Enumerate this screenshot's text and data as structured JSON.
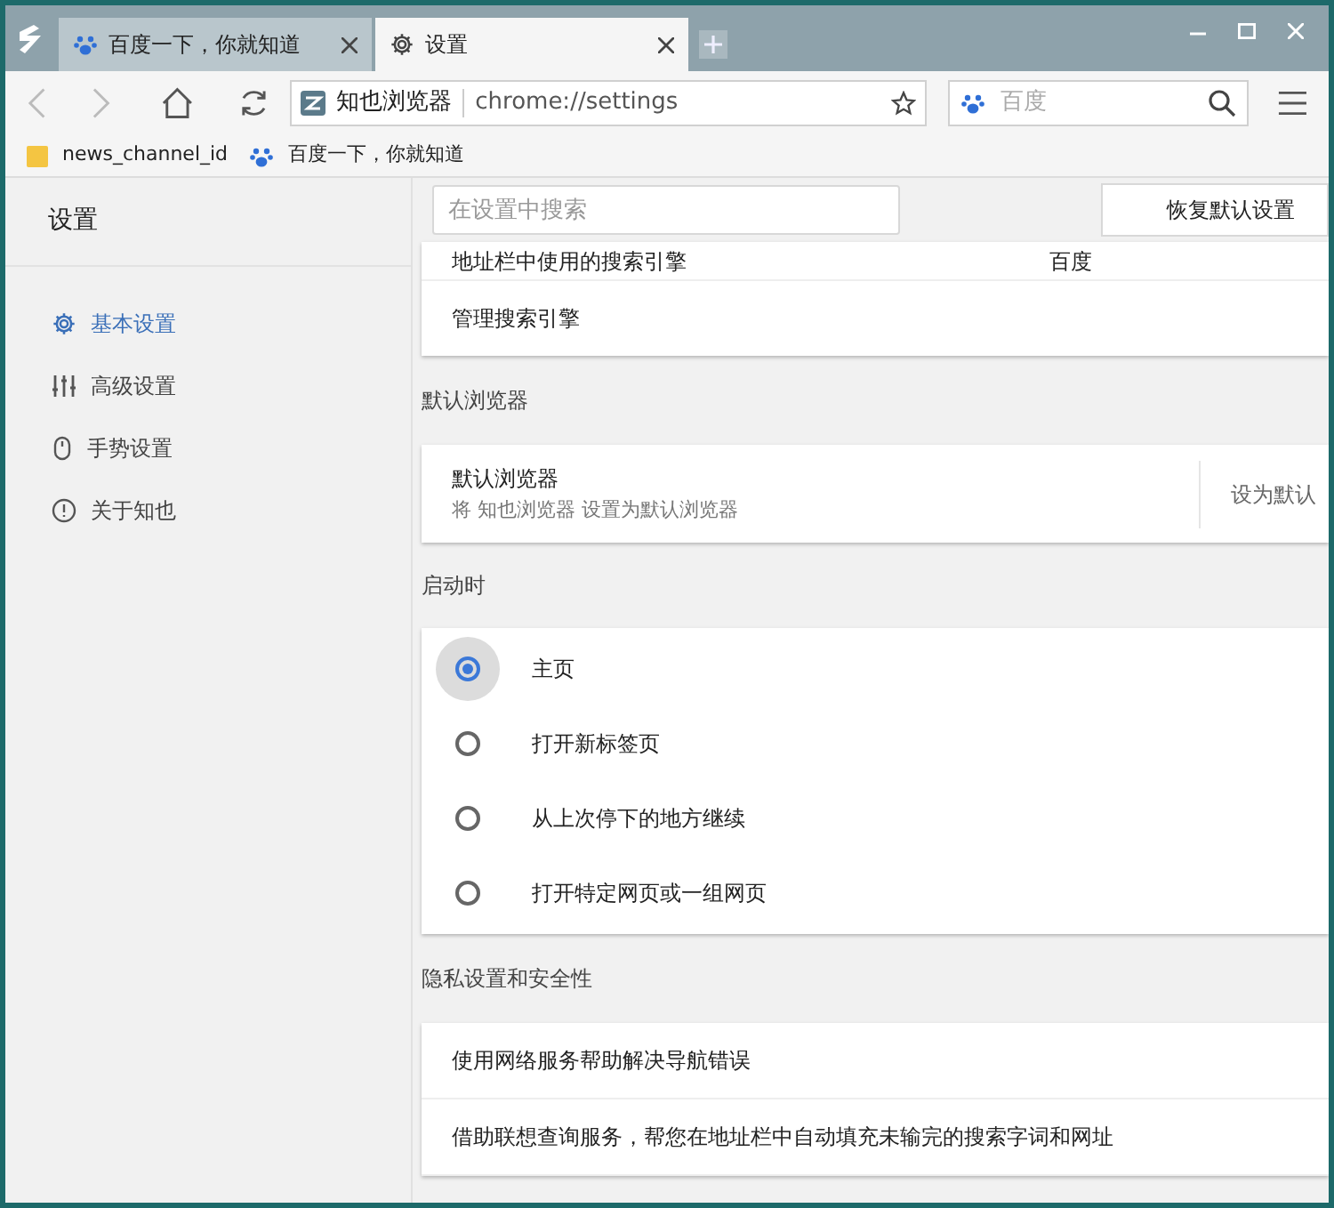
{
  "tabs": [
    {
      "label": "百度一下，你就知道",
      "kind": "paw",
      "selected": false
    },
    {
      "label": "设置",
      "kind": "gear",
      "selected": true
    }
  ],
  "address_bar": {
    "site": "知也浏览器",
    "url": "chrome://settings"
  },
  "search_box": {
    "placeholder": "百度"
  },
  "bookmarks": [
    {
      "label": "news_channel_id",
      "kind": "folder"
    },
    {
      "label": "百度一下，你就知道",
      "kind": "paw"
    }
  ],
  "sidebar": {
    "title": "设置",
    "items": [
      {
        "label": "基本设置",
        "kind": "gear",
        "selected": true
      },
      {
        "label": "高级设置",
        "kind": "sliders",
        "selected": false
      },
      {
        "label": "手势设置",
        "kind": "mouse",
        "selected": false
      },
      {
        "label": "关于知也",
        "kind": "info",
        "selected": false
      }
    ]
  },
  "settings_search": {
    "placeholder": "在设置中搜索"
  },
  "reset_button": "恢复默认设置",
  "search_engine_card": [
    {
      "label": "地址栏中使用的搜索引擎",
      "value": "百度"
    },
    {
      "label": "管理搜索引擎"
    }
  ],
  "default_browser": {
    "heading": "默认浏览器",
    "title": "默认浏览器",
    "description": "将 知也浏览器 设置为默认浏览器",
    "action": "设为默认"
  },
  "startup": {
    "heading": "启动时",
    "options": [
      {
        "label": "主页",
        "selected": true
      },
      {
        "label": "打开新标签页",
        "selected": false
      },
      {
        "label": "从上次停下的地方继续",
        "selected": false
      },
      {
        "label": "打开特定网页或一组网页",
        "selected": false
      }
    ]
  },
  "privacy": {
    "heading": "隐私设置和安全性",
    "rows": [
      "使用网络服务帮助解决导航错误",
      "借助联想查询服务，帮您在地址栏中自动填充未输完的搜索字词和网址"
    ]
  }
}
